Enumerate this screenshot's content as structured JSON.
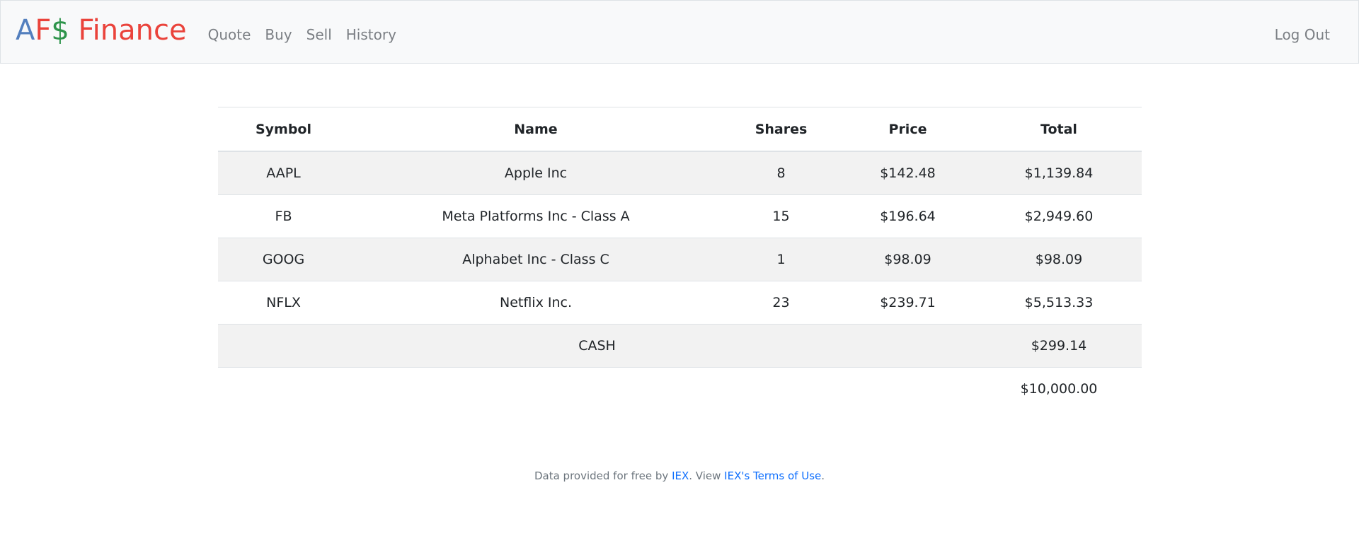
{
  "navbar": {
    "brand": {
      "part1": "A",
      "part2": "F",
      "part3": "$",
      "part4": " Finance"
    },
    "links": [
      "Quote",
      "Buy",
      "Sell",
      "History"
    ],
    "logout_label": "Log Out"
  },
  "table": {
    "headers": [
      "Symbol",
      "Name",
      "Shares",
      "Price",
      "Total"
    ],
    "rows": [
      {
        "symbol": "AAPL",
        "name": "Apple Inc",
        "shares": "8",
        "price": "$142.48",
        "total": "$1,139.84"
      },
      {
        "symbol": "FB",
        "name": "Meta Platforms Inc - Class A",
        "shares": "15",
        "price": "$196.64",
        "total": "$2,949.60"
      },
      {
        "symbol": "GOOG",
        "name": "Alphabet Inc - Class C",
        "shares": "1",
        "price": "$98.09",
        "total": "$98.09"
      },
      {
        "symbol": "NFLX",
        "name": "Netflix Inc.",
        "shares": "23",
        "price": "$239.71",
        "total": "$5,513.33"
      }
    ],
    "cash_label": "CASH",
    "cash_total": "$299.14",
    "grand_total": "$10,000.00"
  },
  "footer": {
    "prefix": "Data provided for free by ",
    "iex_link": "IEX",
    "middle": ". View ",
    "terms_link": "IEX's Terms of Use",
    "suffix": "."
  },
  "colors": {
    "brand_blue": "#537fbe",
    "brand_red": "#ea433b",
    "brand_yellow": "#f5b82e",
    "brand_green": "#2e944b",
    "link": "#0d6efd",
    "navbar_bg": "#f8f9fa",
    "striped_row": "#f2f2f2"
  }
}
